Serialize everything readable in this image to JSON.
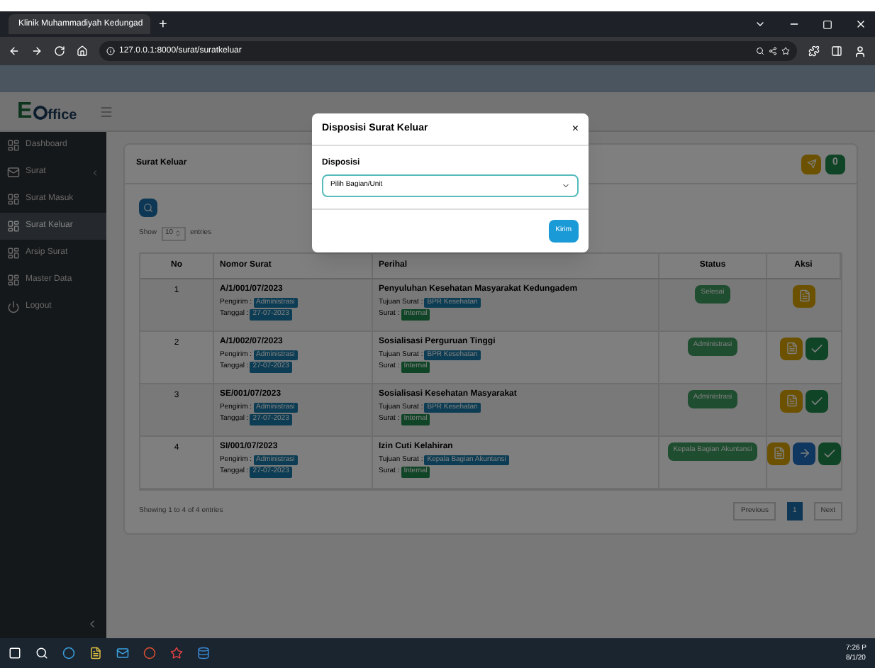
{
  "browser": {
    "tab_title": "Klinik Muhammadiyah Kedungad",
    "new_tab": "+",
    "url": "127.0.0.1:8000/surat/suratkeluar"
  },
  "app": {
    "logo_text": "ffice",
    "logo_mark": "E"
  },
  "sidebar": {
    "items": [
      {
        "label": "Dashboard",
        "selected": false,
        "kind": "item"
      },
      {
        "label": "Surat",
        "selected": false,
        "kind": "group"
      },
      {
        "label": "Surat Masuk",
        "selected": false,
        "kind": "item"
      },
      {
        "label": "Surat Keluar",
        "selected": true,
        "kind": "item"
      },
      {
        "label": "Arsip Surat",
        "selected": false,
        "kind": "item"
      },
      {
        "label": "Master Data",
        "selected": false,
        "kind": "item"
      },
      {
        "label": "Logout",
        "selected": false,
        "kind": "logout"
      }
    ]
  },
  "card": {
    "title": "Surat Keluar",
    "count_badge": "0",
    "show_label": "Show",
    "entries_value": "10",
    "entries_label": "entries",
    "columns": [
      "No",
      "Nomor Surat",
      "Perihal",
      "Status",
      "Aksi"
    ],
    "rows": [
      {
        "no": "1",
        "nomor": "A/1/001/07/2023",
        "pengirim_label": "Pengirim :",
        "pengirim": "Administrasi",
        "tanggal_label": "Tanggal :",
        "tanggal": "27-07-2023",
        "perihal": "Penyuluhan Kesehatan Masyarakat Kedungadem",
        "tujuan_label": "Tujuan Surat :",
        "tujuan": "BPR Kesehatan",
        "surat_label": "Surat :",
        "surat": "Internal",
        "status": "Selesai",
        "actions": [
          {
            "kind": "doc"
          }
        ]
      },
      {
        "no": "2",
        "nomor": "A/1/002/07/2023",
        "pengirim_label": "Pengirim :",
        "pengirim": "Administrasi",
        "tanggal_label": "Tanggal :",
        "tanggal": "27-07-2023",
        "perihal": "Sosialisasi Perguruan Tinggi",
        "tujuan_label": "Tujuan Surat :",
        "tujuan": "BPR Kesehatan",
        "surat_label": "Surat :",
        "surat": "Internal",
        "status": "Administrasi",
        "actions": [
          {
            "kind": "doc"
          },
          {
            "kind": "check"
          }
        ]
      },
      {
        "no": "3",
        "nomor": "SE/001/07/2023",
        "pengirim_label": "Pengirim :",
        "pengirim": "Administrasi",
        "tanggal_label": "Tanggal :",
        "tanggal": "27-07-2023",
        "perihal": "Sosialisasi Kesehatan Masyarakat",
        "tujuan_label": "Tujuan Surat :",
        "tujuan": "BPR Kesehatan",
        "surat_label": "Surat :",
        "surat": "Internal",
        "status": "Administrasi",
        "actions": [
          {
            "kind": "doc"
          },
          {
            "kind": "check"
          }
        ]
      },
      {
        "no": "4",
        "nomor": "SI/001/07/2023",
        "pengirim_label": "Pengirim :",
        "pengirim": "Administrasi",
        "tanggal_label": "Tanggal :",
        "tanggal": "27-07-2023",
        "perihal": "Izin Cuti Kelahiran",
        "tujuan_label": "Tujuan Surat :",
        "tujuan": "Kepala Bagian Akuntansi",
        "surat_label": "Surat :",
        "surat": "Internal",
        "status": "Kepala Bagian Akuntansi",
        "actions": [
          {
            "kind": "doc"
          },
          {
            "kind": "forward"
          },
          {
            "kind": "check"
          }
        ]
      }
    ],
    "info": "Showing 1 to 4 of 4 entries",
    "pagination": [
      {
        "label": "Previous",
        "selected": false
      },
      {
        "label": "1",
        "selected": true
      },
      {
        "label": "Next",
        "selected": false
      }
    ]
  },
  "modal": {
    "title": "Disposisi Surat Keluar",
    "close": "×",
    "field_label": "Disposisi",
    "select_value": "Pilih Bagian/Unit",
    "submit": "Kirim"
  },
  "taskbar": {
    "time": "7:26 P",
    "date": "8/1/20"
  }
}
